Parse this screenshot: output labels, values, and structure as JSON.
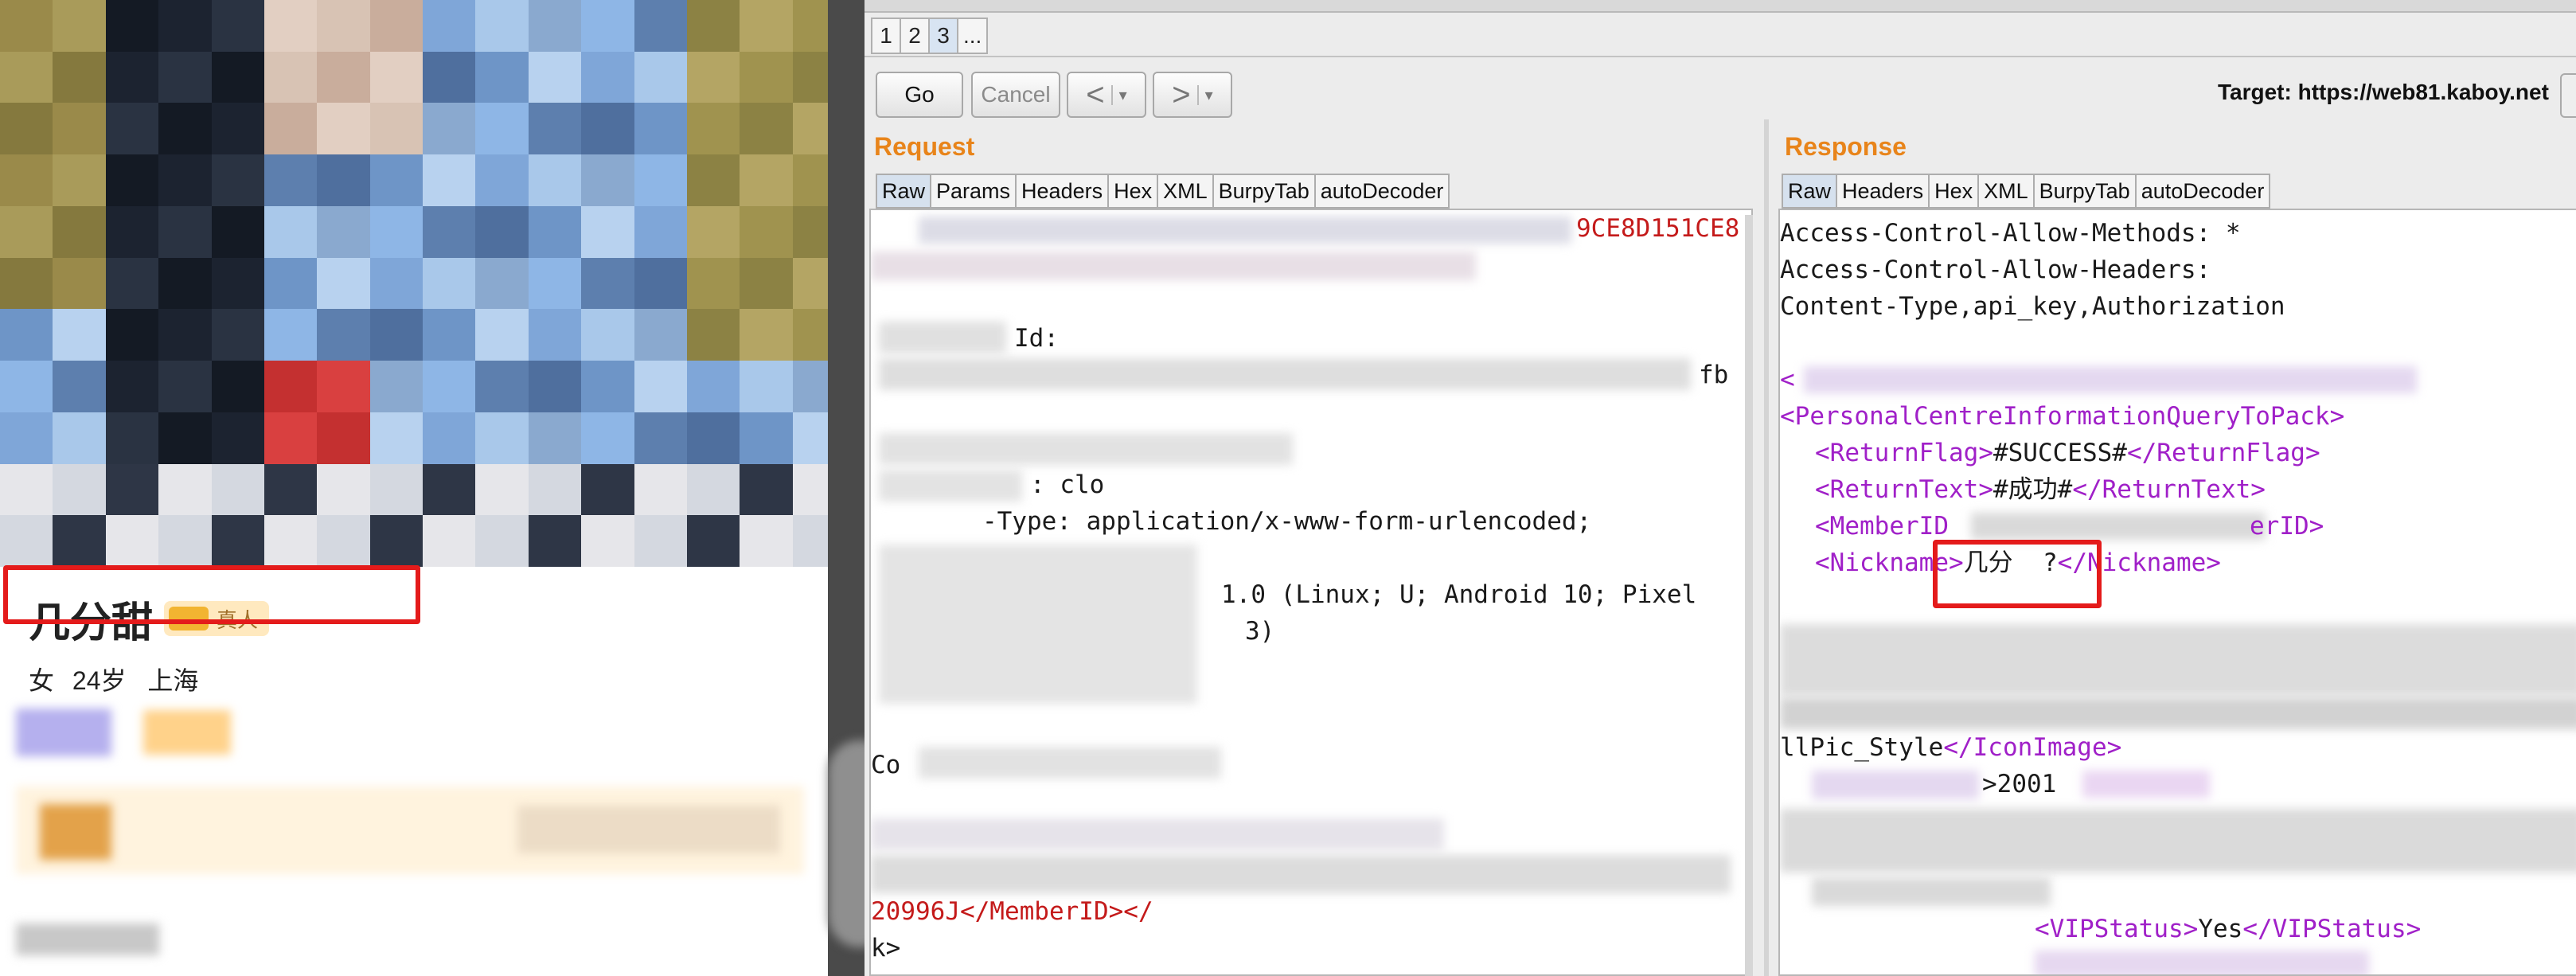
{
  "profile": {
    "name": "几分甜",
    "badge_label": "真人",
    "gender": "女",
    "age": "24岁",
    "city": "上海"
  },
  "repeater": {
    "tabs": [
      "1",
      "2",
      "3",
      "..."
    ],
    "active_tab": "3",
    "go_label": "Go",
    "cancel_label": "Cancel",
    "back_label": "<",
    "forward_label": ">",
    "dropdown_glyph": "▾",
    "target_label": "Target: https://web81.kaboy.net"
  },
  "request": {
    "title": "Request",
    "tabs": [
      "Raw",
      "Params",
      "Headers",
      "Hex",
      "XML",
      "BurpyTab",
      "autoDecoder"
    ],
    "active_tab": "Raw",
    "lines": [
      "9CE8D151CE8",
      "Id:",
      "fb",
      ": clo",
      "-Type: application/x-www-form-urlencoded;",
      "1.0 (Linux; U; Android 10; Pixel",
      "3)",
      "Co",
      "20996J</MemberID></",
      "k>"
    ]
  },
  "response": {
    "title": "Response",
    "tabs": [
      "Raw",
      "Headers",
      "Hex",
      "XML",
      "BurpyTab",
      "autoDecoder"
    ],
    "active_tab": "Raw",
    "headers": [
      "Access-Control-Allow-Methods: *",
      "Access-Control-Allow-Headers:",
      "Content-Type,api_key,Authorization"
    ],
    "root_tag": "PersonalCentreInformationQueryToPack",
    "return_flag_tag": "ReturnFlag",
    "return_flag": "#SUCCESS#",
    "return_text_tag": "ReturnText",
    "return_text": "#成功#",
    "member_id_tag": "MemberID",
    "member_id_close": "erID>",
    "nickname_tag": "Nickname",
    "nickname": "几分  ?",
    "icon_image_text": "llPic_Style",
    "icon_image_tag": "IconImage",
    "role_value": ">2001",
    "vip_status_tag": "VIPStatus",
    "vip_status": "Yes"
  }
}
